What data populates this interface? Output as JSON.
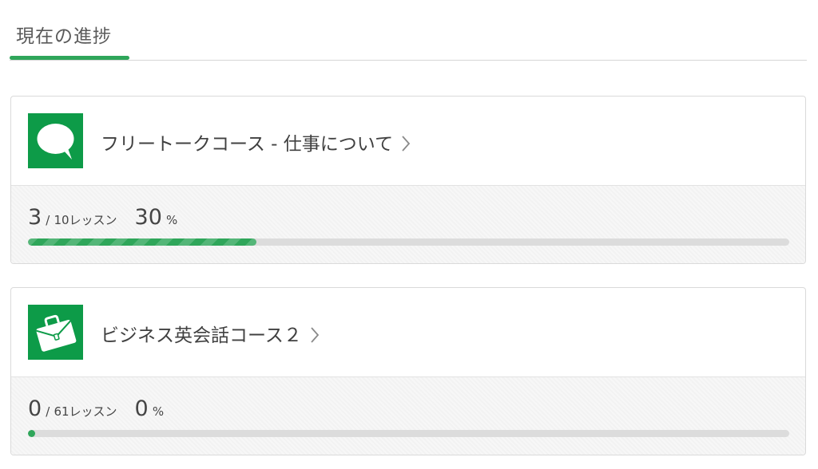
{
  "header": {
    "tab_title": "現在の進捗"
  },
  "courses": [
    {
      "icon": "speech-bubble-icon",
      "title": "フリートークコース - 仕事について",
      "completed": "3",
      "separator": "/",
      "total": "10レッスン",
      "percent_value": "30",
      "percent_sign": "%",
      "progress_fraction": 0.3
    },
    {
      "icon": "briefcase-icon",
      "title": "ビジネス英会話コース２",
      "completed": "0",
      "separator": "/",
      "total": "61レッスン",
      "percent_value": "0",
      "percent_sign": "%",
      "progress_fraction": 0.0
    }
  ],
  "colors": {
    "accent": "#2fa65a",
    "icon_background": "#0d9b48",
    "track": "#dcdcdc"
  }
}
